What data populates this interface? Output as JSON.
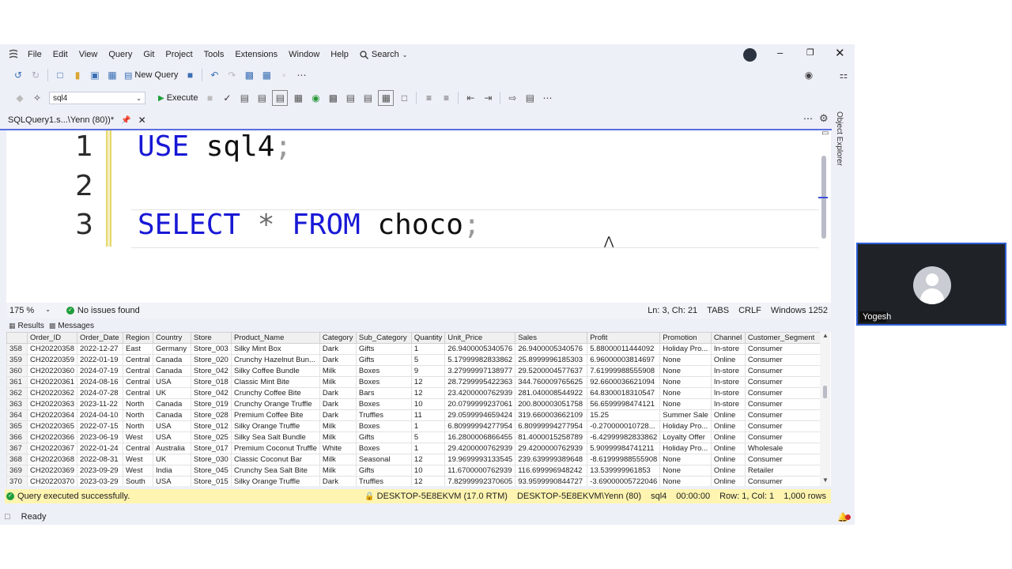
{
  "menu": [
    "File",
    "Edit",
    "View",
    "Query",
    "Git",
    "Project",
    "Tools",
    "Extensions",
    "Window",
    "Help"
  ],
  "search_label": "Search",
  "toolbar": {
    "new_query": "New Query",
    "database": "sql4",
    "execute": "Execute"
  },
  "tab": {
    "title": "SQLQuery1.s...\\Yenn (80))*"
  },
  "editor": {
    "line_numbers": [
      "1",
      "2",
      "3"
    ],
    "line1": {
      "kw": "USE",
      "id": "sql4",
      "semi": ";"
    },
    "line3": {
      "kw1": "SELECT",
      "op": "*",
      "kw2": "FROM",
      "id": "choco",
      "semi": ";"
    }
  },
  "editor_status": {
    "zoom": "175 %",
    "issues": "No issues found",
    "position": "Ln: 3, Ch: 21",
    "tabs": "TABS",
    "eol": "CRLF",
    "encoding": "Windows 1252"
  },
  "results_tabs": {
    "results": "Results",
    "messages": "Messages"
  },
  "grid": {
    "columns": [
      "",
      "Order_ID",
      "Order_Date",
      "Region",
      "Country",
      "Store",
      "Product_Name",
      "Category",
      "Sub_Category",
      "Quantity",
      "Unit_Price",
      "Sales",
      "Profit",
      "Promotion",
      "Channel",
      "Customer_Segment"
    ],
    "rows": [
      [
        "358",
        "CH20220358",
        "2022-12-27",
        "East",
        "Germany",
        "Store_003",
        "Silky Mint Box",
        "Dark",
        "Gifts",
        "1",
        "26.9400005340576",
        "26.9400005340576",
        "5.88000011444092",
        "Holiday Pro...",
        "In-store",
        "Consumer"
      ],
      [
        "359",
        "CH20220359",
        "2022-01-19",
        "Central",
        "Canada",
        "Store_020",
        "Crunchy Hazelnut Bun...",
        "Dark",
        "Gifts",
        "5",
        "5.17999982833862",
        "25.8999996185303",
        "6.96000003814697",
        "None",
        "Online",
        "Consumer"
      ],
      [
        "360",
        "CH20220360",
        "2024-07-19",
        "Central",
        "Canada",
        "Store_042",
        "Silky Coffee Bundle",
        "Milk",
        "Boxes",
        "9",
        "3.27999997138977",
        "29.5200004577637",
        "7.61999988555908",
        "None",
        "In-store",
        "Consumer"
      ],
      [
        "361",
        "CH20220361",
        "2024-08-16",
        "Central",
        "USA",
        "Store_018",
        "Classic Mint Bite",
        "Milk",
        "Boxes",
        "12",
        "28.7299995422363",
        "344.760009765625",
        "92.6600036621094",
        "None",
        "In-store",
        "Consumer"
      ],
      [
        "362",
        "CH20220362",
        "2024-07-28",
        "Central",
        "UK",
        "Store_042",
        "Crunchy Coffee Bite",
        "Dark",
        "Bars",
        "12",
        "23.4200000762939",
        "281.040008544922",
        "64.8300018310547",
        "None",
        "In-store",
        "Consumer"
      ],
      [
        "363",
        "CH20220363",
        "2023-11-22",
        "North",
        "Canada",
        "Store_019",
        "Crunchy Orange Truffle",
        "Dark",
        "Boxes",
        "10",
        "20.0799999237061",
        "200.800003051758",
        "56.6599998474121",
        "None",
        "In-store",
        "Consumer"
      ],
      [
        "364",
        "CH20220364",
        "2024-04-10",
        "North",
        "Canada",
        "Store_028",
        "Premium Coffee Bite",
        "Dark",
        "Truffles",
        "11",
        "29.0599994659424",
        "319.660003662109",
        "15.25",
        "Summer Sale",
        "Online",
        "Consumer"
      ],
      [
        "365",
        "CH20220365",
        "2022-07-15",
        "North",
        "USA",
        "Store_012",
        "Silky Orange Truffle",
        "Milk",
        "Boxes",
        "1",
        "6.80999994277954",
        "6.80999994277954",
        "-0.270000010728...",
        "Holiday Pro...",
        "Online",
        "Consumer"
      ],
      [
        "366",
        "CH20220366",
        "2023-06-19",
        "West",
        "USA",
        "Store_025",
        "Silky Sea Salt Bundle",
        "Milk",
        "Gifts",
        "5",
        "16.2800006866455",
        "81.4000015258789",
        "-6.42999982833862",
        "Loyalty Offer",
        "Online",
        "Consumer"
      ],
      [
        "367",
        "CH20220367",
        "2022-01-24",
        "Central",
        "Australia",
        "Store_017",
        "Premium Coconut Truffle",
        "White",
        "Boxes",
        "1",
        "29.4200000762939",
        "29.4200000762939",
        "5.90999984741211",
        "Holiday Pro...",
        "Online",
        "Wholesale"
      ],
      [
        "368",
        "CH20220368",
        "2022-08-31",
        "West",
        "UK",
        "Store_030",
        "Classic Coconut Bar",
        "Milk",
        "Seasonal",
        "12",
        "19.9699993133545",
        "239.639999389648",
        "-8.61999988555908",
        "None",
        "Online",
        "Consumer"
      ],
      [
        "369",
        "CH20220369",
        "2023-09-29",
        "West",
        "India",
        "Store_045",
        "Crunchy Sea Salt Bite",
        "Milk",
        "Gifts",
        "10",
        "11.6700000762939",
        "116.699996948242",
        "13.539999961853",
        "None",
        "Online",
        "Retailer"
      ],
      [
        "370",
        "CH20220370",
        "2023-03-29",
        "South",
        "USA",
        "Store_015",
        "Silky Orange Truffle",
        "Dark",
        "Truffles",
        "12",
        "7.82999992370605",
        "93.9599990844727",
        "-3.69000005722046",
        "None",
        "Online",
        "Consumer"
      ]
    ]
  },
  "query_status": {
    "message": "Query executed successfully.",
    "server": "DESKTOP-5E8EKVM (17.0 RTM)",
    "user": "DESKTOP-5E8EKVM\\Yenn (80)",
    "db": "sql4",
    "time": "00:00:00",
    "rowcol": "Row: 1, Col: 1",
    "rows": "1,000 rows"
  },
  "status": {
    "ready": "Ready"
  },
  "object_explorer": "Object Explorer",
  "video": {
    "name": "Yogesh"
  }
}
